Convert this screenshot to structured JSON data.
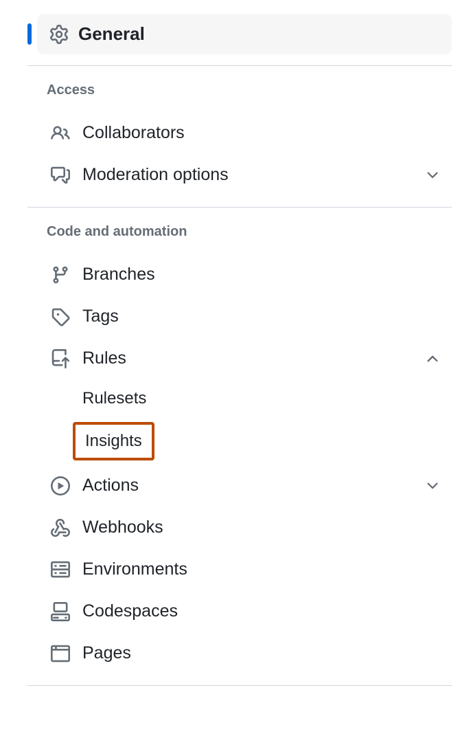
{
  "sidebar": {
    "general": {
      "label": "General"
    },
    "sections": {
      "access": {
        "title": "Access",
        "items": {
          "collaborators": "Collaborators",
          "moderation": "Moderation options"
        }
      },
      "code_automation": {
        "title": "Code and automation",
        "items": {
          "branches": "Branches",
          "tags": "Tags",
          "rules": "Rules",
          "rules_sub": {
            "rulesets": "Rulesets",
            "insights": "Insights"
          },
          "actions": "Actions",
          "webhooks": "Webhooks",
          "environments": "Environments",
          "codespaces": "Codespaces",
          "pages": "Pages"
        }
      }
    }
  }
}
